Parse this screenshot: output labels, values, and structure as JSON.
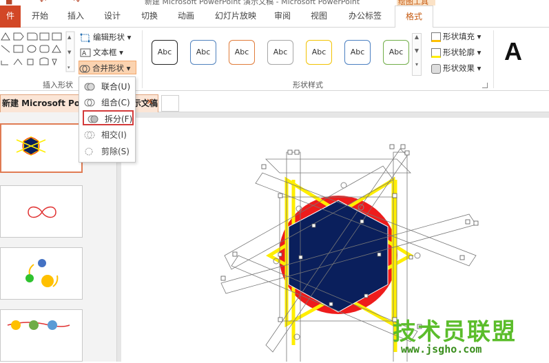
{
  "window": {
    "title": "新建 Microsoft PowerPoint 演示文稿 - Microsoft PowerPoint",
    "context_tab_group": "绘图工具"
  },
  "tabs": [
    {
      "label": "件",
      "kind": "file"
    },
    {
      "label": "开始"
    },
    {
      "label": "插入"
    },
    {
      "label": "设计"
    },
    {
      "label": "切换"
    },
    {
      "label": "动画"
    },
    {
      "label": "幻灯片放映"
    },
    {
      "label": "审阅"
    },
    {
      "label": "视图"
    },
    {
      "label": "办公标签"
    },
    {
      "label": "格式",
      "active": true
    }
  ],
  "ribbon": {
    "insert_shapes": {
      "label": "插入形状",
      "edit_shape": "编辑形状",
      "text_box": "文本框",
      "merge_shapes": "合并形状"
    },
    "shape_styles": {
      "label": "形状样式",
      "styles": [
        {
          "text": "Abc",
          "color": "#222222"
        },
        {
          "text": "Abc",
          "color": "#4f81bd"
        },
        {
          "text": "Abc",
          "color": "#e07b39"
        },
        {
          "text": "Abc",
          "color": "#a5a5a5"
        },
        {
          "text": "Abc",
          "color": "#f2c200"
        },
        {
          "text": "Abc",
          "color": "#4a7fc1"
        },
        {
          "text": "Abc",
          "color": "#70ad47"
        }
      ],
      "fill": "形状填充",
      "outline": "形状轮廓",
      "effects": "形状效果"
    },
    "wordart_letter": "A"
  },
  "merge_menu": {
    "items": [
      {
        "label": "联合(U)",
        "icon": "union-icon"
      },
      {
        "label": "组合(C)",
        "icon": "combine-icon"
      },
      {
        "label": "拆分(F)",
        "icon": "fragment-icon",
        "highlighted": true
      },
      {
        "label": "相交(I)",
        "icon": "intersect-icon"
      },
      {
        "label": "剪除(S)",
        "icon": "subtract-icon"
      }
    ]
  },
  "doc_tab": {
    "label": "新建 Microsoft PowerPoint 演示文稿",
    "close": "✕"
  },
  "colors": {
    "accent": "#c55a11",
    "file_tab": "#d24726",
    "highlight_box": "#d33a3a",
    "shape_red": "#ee1c1c",
    "shape_navy": "#0a1f5c",
    "shape_yellow": "#ffee00"
  },
  "watermark": {
    "main": "技术员联盟",
    "url": "www.jsgho.com"
  }
}
